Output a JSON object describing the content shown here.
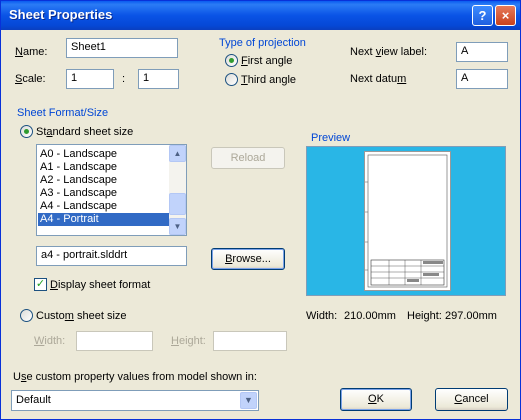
{
  "window": {
    "title": "Sheet Properties",
    "help_glyph": "?",
    "close_glyph": "×"
  },
  "name": {
    "label_u": "N",
    "label_rest": "ame:",
    "value": "Sheet1"
  },
  "scale": {
    "label_u": "S",
    "label_rest": "cale:",
    "num": "1",
    "sep": ":",
    "den": "1"
  },
  "projection": {
    "group_label": "Type of projection",
    "first": {
      "u": "F",
      "rest": "irst angle",
      "selected": true
    },
    "third": {
      "u": "T",
      "rest": "hird angle",
      "selected": false
    }
  },
  "next_view": {
    "pre": "Next ",
    "u": "v",
    "rest": "iew label:",
    "value": "A"
  },
  "next_datum": {
    "pre": "Next datu",
    "u": "m",
    "rest": "",
    "value": "A"
  },
  "sheet_format": {
    "group_label": "Sheet Format/Size",
    "standard": {
      "pre": "St",
      "u": "a",
      "rest": "ndard sheet size",
      "selected": true
    },
    "sizes": [
      "A0 - Landscape",
      "A1 - Landscape",
      "A2 - Landscape",
      "A3 - Landscape",
      "A4 - Landscape",
      "A4 - Portrait"
    ],
    "selected_index": 5,
    "reload_label": "Reload",
    "file": "a4 - portrait.slddrt",
    "browse": {
      "u": "B",
      "rest": "rowse..."
    },
    "display_format": {
      "u": "D",
      "rest": "isplay sheet format",
      "checked": true
    },
    "custom": {
      "pre": "Custo",
      "u": "m",
      "rest": " sheet size",
      "selected": false
    },
    "width": {
      "u": "W",
      "rest": "idth:",
      "value": ""
    },
    "height": {
      "u": "H",
      "rest": "eight:",
      "value": ""
    }
  },
  "preview": {
    "label": "Preview",
    "width_label": "Width:",
    "width_value": "210.00mm",
    "height_label": "Height:",
    "height_value": "297.00mm"
  },
  "custom_property": {
    "pre": "U",
    "u": "s",
    "rest": "e custom property values from model shown in:",
    "selected": "Default"
  },
  "buttons": {
    "ok": {
      "u": "O",
      "rest": "K"
    },
    "cancel": {
      "u": "C",
      "rest": "ancel"
    }
  },
  "colors": {
    "title_bar": "#0a53e6",
    "preview_bg": "#29b6e6",
    "selection": "#316ac5",
    "group_label": "#0046d5"
  }
}
